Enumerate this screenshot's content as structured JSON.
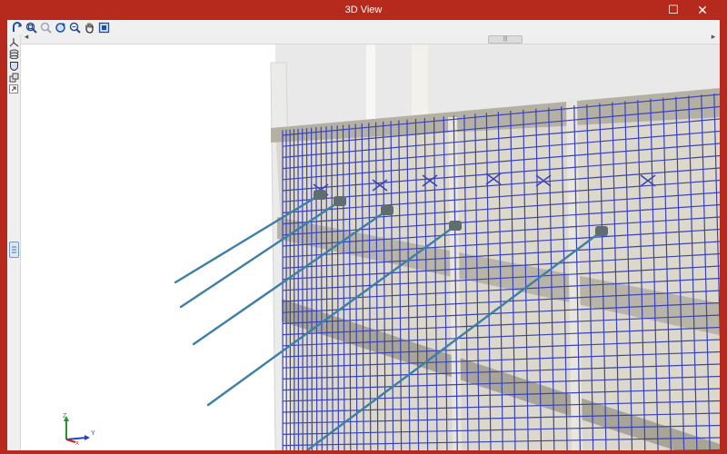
{
  "window": {
    "title": "3D View",
    "maximize_glyph": "☐",
    "close_glyph": "✕"
  },
  "toolbar": {
    "tools": [
      {
        "icon": "rotate-icon"
      },
      {
        "icon": "zoom-all-icon"
      },
      {
        "icon": "zoom-window-icon"
      },
      {
        "icon": "refresh-view-icon"
      },
      {
        "icon": "zoom-icon"
      },
      {
        "icon": "pan-hand-icon"
      },
      {
        "icon": "view-options-icon"
      }
    ]
  },
  "scrollbar": {
    "left_arrow": "◂",
    "right_arrow": "▸",
    "thumb_glyph": "|||"
  },
  "side_tools": [
    {
      "icon": "axis-view-icon"
    },
    {
      "icon": "layers-icon"
    },
    {
      "icon": "shield-icon"
    },
    {
      "icon": "copy-view-icon"
    },
    {
      "icon": "expand-panel-icon"
    }
  ],
  "axes": {
    "z_label": "Z",
    "y_label": "Y",
    "x_label": "X",
    "z_color": "#1f9a2a",
    "y_color": "#2244cc",
    "x_color": "#cc2222"
  },
  "colors": {
    "titlebar": "#b52a1c",
    "rebar": "#3a43b8",
    "tendon": "#3d7fa6",
    "concrete": "#dcd8cc",
    "beam": "#b4b1a4"
  }
}
